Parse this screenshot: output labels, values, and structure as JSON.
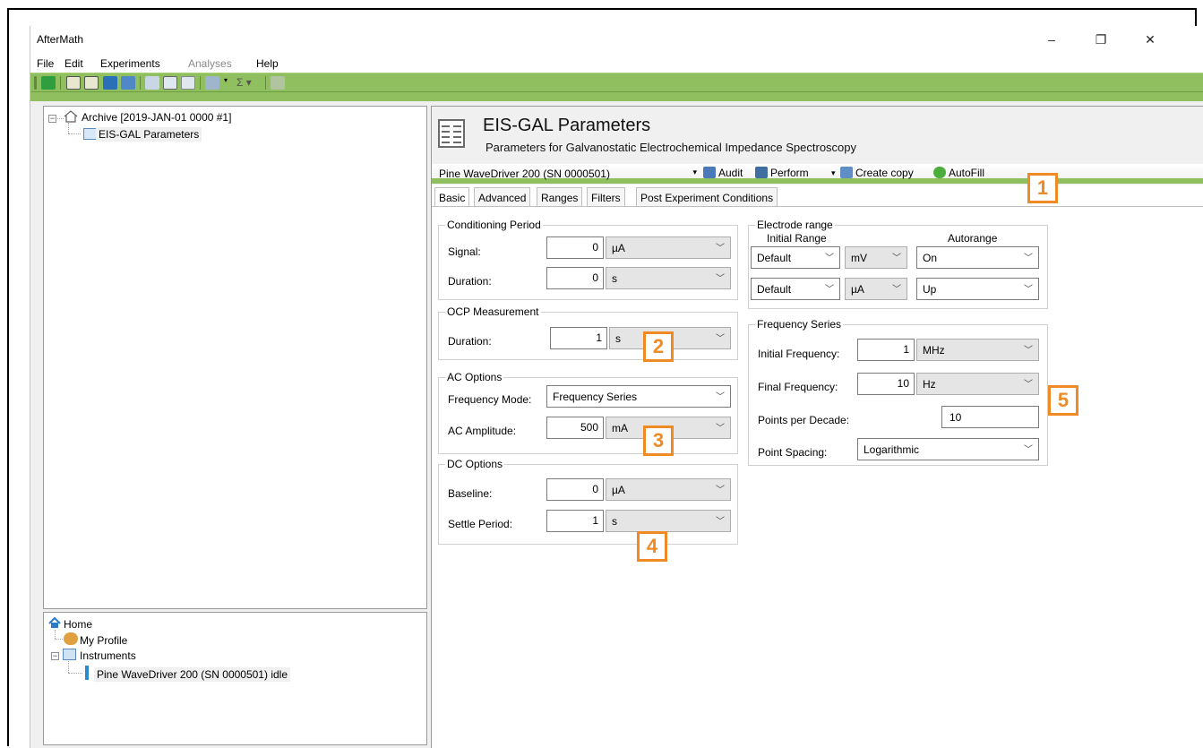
{
  "window": {
    "title": "AfterMath",
    "minimize": "–",
    "maximize": "❐",
    "close": "✕"
  },
  "menu": {
    "file": "File",
    "edit": "Edit",
    "experiments": "Experiments",
    "analyses": "Analyses",
    "help": "Help"
  },
  "toolbar": {
    "sigma": "Σ ▾"
  },
  "tree_top": {
    "archive": "Archive [2019-JAN-01 0000 #1]",
    "params": "EIS-GAL Parameters"
  },
  "tree_bottom": {
    "home": "Home",
    "profile": "My Profile",
    "instruments": "Instruments",
    "device": "Pine WaveDriver 200 (SN 0000501) idle"
  },
  "header": {
    "title": "EIS-GAL Parameters",
    "subtitle": "Parameters for Galvanostatic Electrochemical Impedance Spectroscopy"
  },
  "instrument_bar": {
    "selected": "Pine WaveDriver 200 (SN 0000501)",
    "audit": "Audit",
    "perform": "Perform",
    "create_copy": "Create copy",
    "autofill": "AutoFill"
  },
  "tabs": [
    "Basic",
    "Advanced",
    "Ranges",
    "Filters",
    "Post Experiment Conditions"
  ],
  "conditioning": {
    "title": "Conditioning Period",
    "signal_label": "Signal:",
    "signal_value": "0",
    "signal_unit": "µA",
    "duration_label": "Duration:",
    "duration_value": "0",
    "duration_unit": "s"
  },
  "ocp": {
    "title": "OCP Measurement",
    "duration_label": "Duration:",
    "duration_value": "1",
    "duration_unit": "s"
  },
  "ac": {
    "title": "AC Options",
    "mode_label": "Frequency Mode:",
    "mode_value": "Frequency Series",
    "amp_label": "AC Amplitude:",
    "amp_value": "500",
    "amp_unit": "mA"
  },
  "dc": {
    "title": "DC Options",
    "baseline_label": "Baseline:",
    "baseline_value": "0",
    "baseline_unit": "µA",
    "settle_label": "Settle Period:",
    "settle_value": "1",
    "settle_unit": "s"
  },
  "electrode": {
    "title": "Electrode range",
    "initial_header": "Initial Range",
    "autorange_header": "Autorange",
    "row1": {
      "range": "Default",
      "unit": "mV",
      "auto": "On"
    },
    "row2": {
      "range": "Default",
      "unit": "µA",
      "auto": "Up"
    }
  },
  "freq": {
    "title": "Frequency Series",
    "initial_label": "Initial Frequency:",
    "initial_value": "1",
    "initial_unit": "MHz",
    "final_label": "Final Frequency:",
    "final_value": "10",
    "final_unit": "Hz",
    "ppd_label": "Points per Decade:",
    "ppd_value": "10",
    "spacing_label": "Point Spacing:",
    "spacing_value": "Logarithmic"
  },
  "markers": [
    "1",
    "2",
    "3",
    "4",
    "5"
  ],
  "colors": {
    "accent_green": "#8fbf5f",
    "marker_orange": "#f08a24"
  }
}
